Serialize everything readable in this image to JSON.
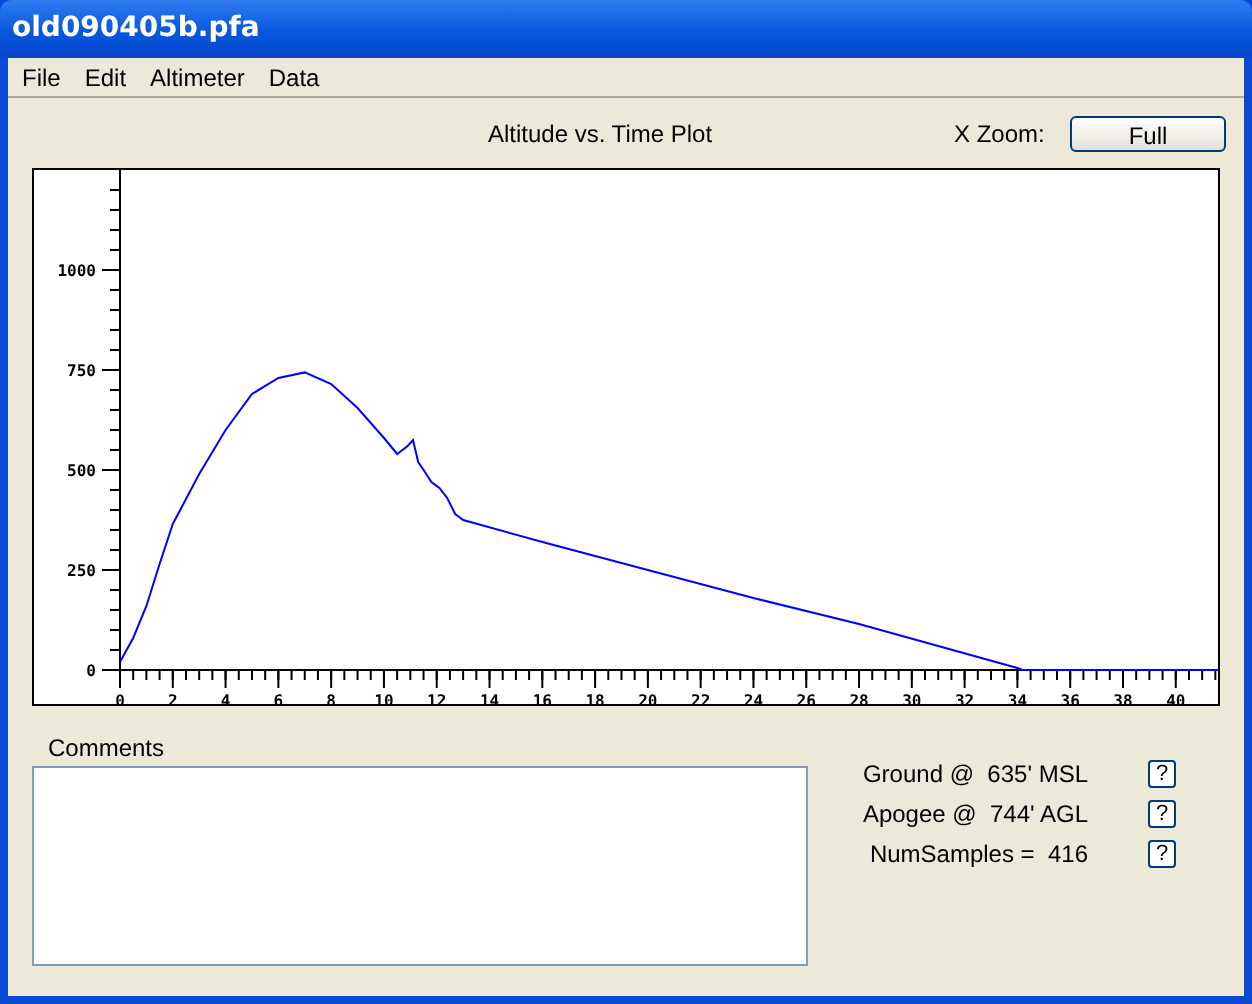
{
  "window": {
    "title": "old090405b.pfa"
  },
  "menu": [
    "File",
    "Edit",
    "Altimeter",
    "Data"
  ],
  "plot": {
    "title": "Altitude vs. Time Plot",
    "x_zoom_label": "X Zoom:",
    "x_zoom_button": "Full",
    "chart_data": {
      "type": "line",
      "x": [
        0,
        0.5,
        1,
        1.5,
        2,
        3,
        4,
        5,
        6,
        7,
        8,
        9,
        10,
        10.5,
        10.9,
        11.1,
        11.3,
        11.5,
        11.8,
        12.1,
        12.4,
        12.7,
        13,
        16,
        20,
        24,
        28,
        31,
        34,
        34.2,
        36,
        41.6
      ],
      "series": [
        {
          "color": "#0000ff",
          "values": [
            20,
            80,
            160,
            265,
            365,
            490,
            600,
            690,
            730,
            744,
            715,
            655,
            580,
            540,
            560,
            575,
            520,
            500,
            470,
            455,
            430,
            390,
            375,
            320,
            250,
            180,
            115,
            60,
            5,
            0,
            0,
            0
          ]
        }
      ],
      "xlim": [
        0,
        41.6
      ],
      "ylim": [
        0,
        1240
      ],
      "xticks": [
        0,
        2,
        4,
        6,
        8,
        10,
        12,
        14,
        16,
        18,
        20,
        22,
        24,
        26,
        28,
        30,
        32,
        34,
        36,
        38,
        40
      ],
      "yticks": [
        0,
        250,
        500,
        750,
        1000
      ]
    }
  },
  "comments": {
    "label": "Comments"
  },
  "info": [
    {
      "text": "Ground @  635' MSL",
      "help": "?"
    },
    {
      "text": "Apogee @  744' AGL",
      "help": "?"
    },
    {
      "text": "NumSamples =  416",
      "help": "?"
    }
  ]
}
